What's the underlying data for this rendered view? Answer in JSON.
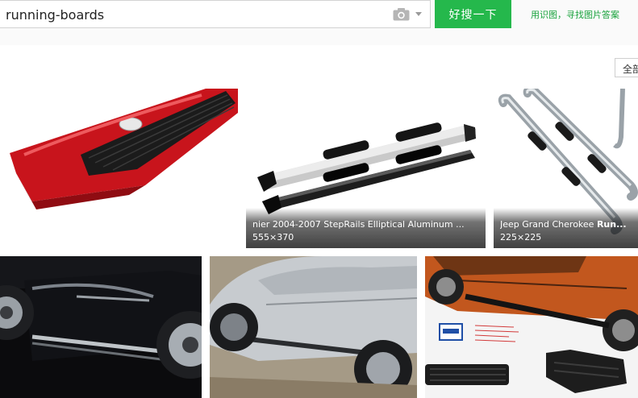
{
  "search": {
    "query": "running-boards",
    "button_label": "好搜一下",
    "camera_icon": "camera-icon",
    "dropdown_icon": "chevron-down-icon"
  },
  "header": {
    "image_answer_link": "用识图，寻找图片答案",
    "filter_button": "全部"
  },
  "results": [
    {
      "id": "red-running-board",
      "title": "",
      "size": ""
    },
    {
      "id": "black-steprails",
      "title_prefix": "nier 2004-2007 StepRails Elliptical Aluminum ...",
      "size": "555×370"
    },
    {
      "id": "chrome-nerf-bars",
      "title_prefix": "Jeep Grand Cherokee ",
      "title_bold": "Run...",
      "size": "225×225"
    },
    {
      "id": "black-suv-side-steps",
      "title": "",
      "size": ""
    },
    {
      "id": "silver-suv-running-boards",
      "title": "",
      "size": ""
    },
    {
      "id": "orange-suv-running-boards",
      "title": "",
      "size": ""
    }
  ],
  "colors": {
    "accent_green": "#25b84c",
    "link_green": "#1aa33d",
    "header_bg": "#fafafa"
  }
}
